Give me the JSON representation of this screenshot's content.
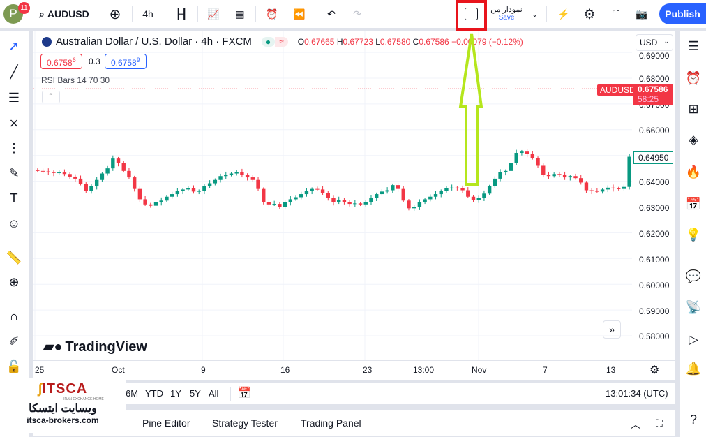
{
  "topbar": {
    "avatar_letter": "P",
    "notif_count": "11",
    "symbol": "AUDUSD",
    "interval": "4h",
    "layout_name": "نمودار من",
    "save_label": "Save",
    "publish_label": "Publish"
  },
  "legend": {
    "title": "Australian Dollar / U.S. Dollar · 4h · FXCM",
    "o_label": "O",
    "o": "0.67665",
    "h_label": "H",
    "h": "0.67723",
    "l_label": "L",
    "l": "0.67580",
    "c_label": "C",
    "c": "0.67586",
    "change": "−0.00079 (−0.12%)",
    "sell": "0.6758",
    "sell_sup": "6",
    "spread": "0.3",
    "buy": "0.6758",
    "buy_sup": "9",
    "indicator": "RSI Bars 14 70 30"
  },
  "price_axis": {
    "currency": "USD",
    "labels": [
      "0.69000",
      "0.68000",
      "0.67000",
      "0.66000",
      "0.65000",
      "0.64000",
      "0.63000",
      "0.62000",
      "0.61000",
      "0.60000",
      "0.59000",
      "0.58000"
    ],
    "last_symbol": "AUDUSD",
    "last_price": "0.67586",
    "countdown": "58:25",
    "crosshair_price": "0.64950"
  },
  "time_axis": {
    "labels": [
      "25",
      "Oct",
      "9",
      "16",
      "23",
      "13:00",
      "Nov",
      "7",
      "13"
    ]
  },
  "watermark": "TradingView",
  "range_bar": {
    "items": [
      "6M",
      "YTD",
      "1Y",
      "5Y",
      "All"
    ],
    "clock": "13:01:34 (UTC)"
  },
  "bottom_tabs": [
    "Pine Editor",
    "Strategy Tester",
    "Trading Panel"
  ],
  "overlay_logo": {
    "brand": "ITSCA",
    "tagline": "IRAN EXCHANGE HOME",
    "fa": "وبسایت ایتسکا",
    "url": "itsca-brokers.com"
  },
  "colors": {
    "up": "#089981",
    "down": "#f23645",
    "accent": "#2962ff",
    "annotation_box": "#e8141c",
    "annotation_arrow": "#b5e61d"
  },
  "chart_data": {
    "type": "candlestick",
    "ylim": [
      0.575,
      0.69
    ],
    "closes": [
      0.644,
      0.6438,
      0.6436,
      0.6432,
      0.6434,
      0.6428,
      0.6418,
      0.641,
      0.639,
      0.6362,
      0.638,
      0.6405,
      0.643,
      0.645,
      0.6488,
      0.647,
      0.644,
      0.6415,
      0.637,
      0.633,
      0.631,
      0.6305,
      0.6318,
      0.6325,
      0.634,
      0.635,
      0.6362,
      0.6368,
      0.6372,
      0.636,
      0.6362,
      0.638,
      0.6392,
      0.6405,
      0.642,
      0.6425,
      0.643,
      0.6436,
      0.6425,
      0.6415,
      0.6405,
      0.637,
      0.632,
      0.631,
      0.6312,
      0.63,
      0.6318,
      0.633,
      0.6338,
      0.635,
      0.6362,
      0.637,
      0.6368,
      0.6355,
      0.6335,
      0.6318,
      0.6328,
      0.6318,
      0.6312,
      0.6314,
      0.631,
      0.6318,
      0.6335,
      0.635,
      0.636,
      0.6365,
      0.6385,
      0.637,
      0.6325,
      0.6295,
      0.63,
      0.6318,
      0.633,
      0.634,
      0.635,
      0.6362,
      0.6372,
      0.6375,
      0.6374,
      0.6365,
      0.634,
      0.6326,
      0.6335,
      0.6352,
      0.638,
      0.641,
      0.6435,
      0.644,
      0.647,
      0.651,
      0.6515,
      0.6505,
      0.649,
      0.646,
      0.6425,
      0.642,
      0.6428,
      0.6425,
      0.6415,
      0.642,
      0.6412,
      0.6395,
      0.6365,
      0.6362,
      0.636,
      0.6368,
      0.6375,
      0.6372,
      0.637,
      0.6378,
      0.6495
    ]
  }
}
